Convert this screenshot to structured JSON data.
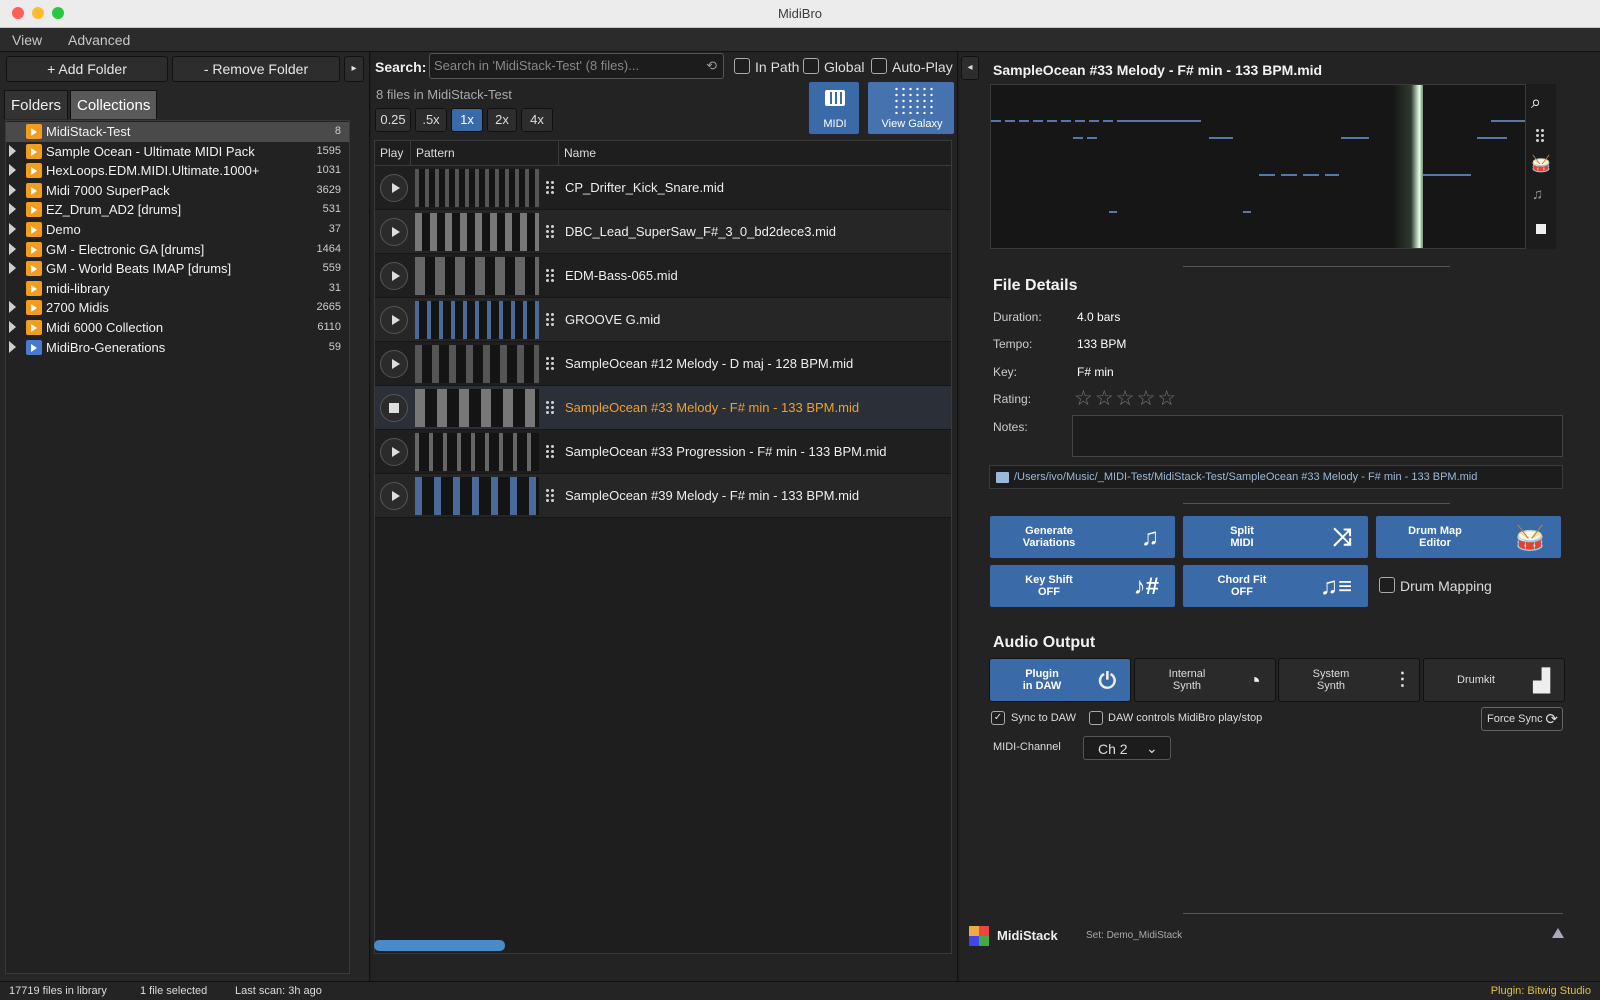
{
  "window": {
    "title": "MidiBro"
  },
  "menu": [
    "View",
    "Advanced"
  ],
  "left": {
    "add_folder": "+ Add Folder",
    "remove_folder": "- Remove Folder",
    "tabs": [
      "Folders",
      "Collections"
    ],
    "tree": [
      {
        "label": "MidiStack-Test",
        "count": "8",
        "selected": true,
        "expandable": false
      },
      {
        "label": "Sample Ocean - Ultimate MIDI Pack",
        "count": "1595",
        "expandable": true
      },
      {
        "label": "HexLoops.EDM.MIDI.Ultimate.1000+",
        "count": "1031",
        "expandable": true
      },
      {
        "label": "Midi 7000 SuperPack",
        "count": "3629",
        "expandable": true
      },
      {
        "label": "EZ_Drum_AD2 [drums]",
        "count": "531",
        "expandable": true
      },
      {
        "label": "Demo",
        "count": "37",
        "expandable": true
      },
      {
        "label": "GM - Electronic GA [drums]",
        "count": "1464",
        "expandable": true
      },
      {
        "label": "GM - World Beats IMAP [drums]",
        "count": "559",
        "expandable": true
      },
      {
        "label": "midi-library",
        "count": "31",
        "expandable": false
      },
      {
        "label": "2700 Midis",
        "count": "2665",
        "expandable": true
      },
      {
        "label": "Midi 6000 Collection",
        "count": "6110",
        "expandable": true
      },
      {
        "label": "MidiBro-Generations",
        "count": "59",
        "expandable": true,
        "blue": true
      }
    ]
  },
  "search": {
    "label": "Search:",
    "placeholder": "Search in 'MidiStack-Test' (8 files)...",
    "in_path": "In Path",
    "global": "Global",
    "auto_play": "Auto-Play",
    "summary": "8 files in MidiStack-Test",
    "speeds": [
      "0.25",
      ".5x",
      "1x",
      "2x",
      "4x"
    ],
    "active_speed": "1x",
    "midi_btn": "MIDI",
    "galaxy_btn": "View Galaxy"
  },
  "table": {
    "headers": [
      "Play",
      "Pattern",
      "Name"
    ],
    "rows": [
      {
        "name": "CP_Drifter_Kick_Snare.mid"
      },
      {
        "name": "DBC_Lead_SuperSaw_F#_3_0_bd2dece3.mid"
      },
      {
        "name": "EDM-Bass-065.mid"
      },
      {
        "name": "GROOVE G.mid"
      },
      {
        "name": "SampleOcean #12 Melody - D maj - 128 BPM.mid"
      },
      {
        "name": "SampleOcean #33 Melody - F# min - 133 BPM.mid",
        "playing": true
      },
      {
        "name": "SampleOcean #33 Progression - F# min - 133 BPM.mid"
      },
      {
        "name": "SampleOcean #39 Melody - F# min - 133 BPM.mid"
      }
    ]
  },
  "detail": {
    "file_title": "SampleOcean #33 Melody - F# min - 133 BPM.mid",
    "section": "File Details",
    "duration_label": "Duration:",
    "duration": "4.0 bars",
    "tempo_label": "Tempo:",
    "tempo": "133 BPM",
    "key_label": "Key:",
    "key": "F# min",
    "rating_label": "Rating:",
    "rating": "☆☆☆☆☆",
    "notes_label": "Notes:",
    "path": "/Users/ivo/Music/_MIDI-Test/MidiStack-Test/SampleOcean #33 Melody - F# min - 133 BPM.mid"
  },
  "actions": {
    "generate": "Generate\nVariations",
    "split": "Split\nMIDI",
    "drum_map": "Drum Map\nEditor",
    "key_shift": "Key Shift\nOFF",
    "chord_fit": "Chord Fit\nOFF",
    "drum_mapping": "Drum Mapping"
  },
  "audio": {
    "section": "Audio Output",
    "options": [
      {
        "label": "Plugin\nin DAW",
        "active": true
      },
      {
        "label": "Internal\nSynth"
      },
      {
        "label": "System\nSynth"
      },
      {
        "label": "Drumkit"
      }
    ],
    "sync_daw": "Sync to DAW",
    "daw_controls": "DAW controls MidiBro play/stop",
    "force_sync": "Force Sync",
    "channel_label": "MIDI-Channel",
    "channel": "Ch 2"
  },
  "footer": {
    "brand": "MidiStack",
    "set": "Set: Demo_MidiStack"
  },
  "status": {
    "files": "17719 files in library",
    "selected": "1 file selected",
    "scan": "Last scan: 3h ago",
    "plugin": "Plugin: Bitwig Studio"
  },
  "colors": {
    "accent": "#3a6aa8",
    "folder": "#f39c1f",
    "playing": "#f0a030",
    "plugin_status": "#e0c040"
  }
}
